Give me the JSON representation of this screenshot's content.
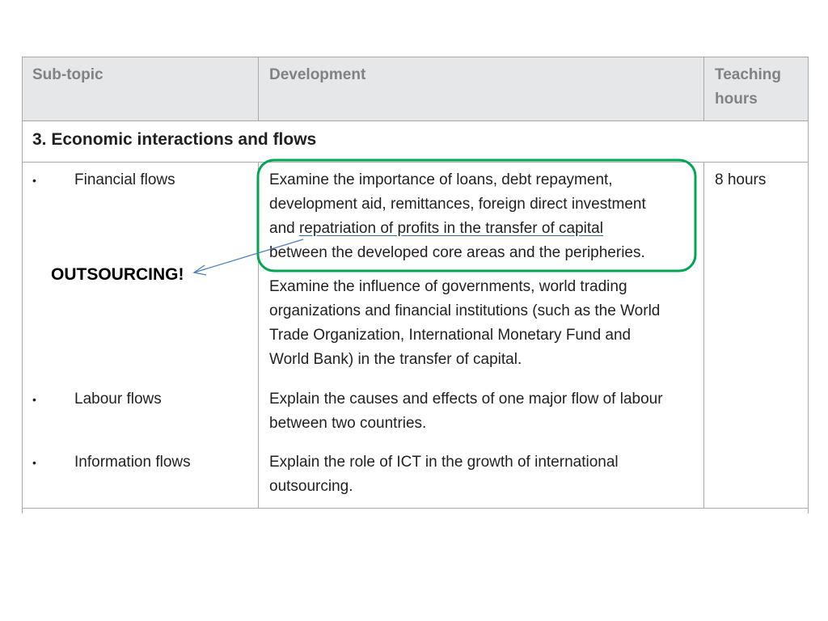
{
  "table": {
    "headers": {
      "subtopic": "Sub-topic",
      "development": "Development",
      "teaching_hours_line1": "Teaching",
      "teaching_hours_line2": "hours"
    },
    "section_title": "3. Economic interactions and flows",
    "rows": [
      {
        "bullet": "•",
        "subtopic": "Financial flows",
        "development_1": {
          "line1": "Examine the importance of loans, debt repayment,",
          "line2": "development aid, remittances, foreign direct investment",
          "line3_pre": "and ",
          "line3_underlined": "repatriation of profits in the transfer of capital",
          "line4": "between the developed core areas and the peripheries."
        },
        "development_2": {
          "line1": "Examine the influence of governments, world trading",
          "line2": "organizations and financial institutions (such as the World",
          "line3": "Trade Organization, International Monetary Fund and",
          "line4": "World Bank) in the transfer of capital."
        },
        "hours": "8 hours"
      },
      {
        "bullet": "•",
        "subtopic": "Labour flows",
        "development": {
          "line1": "Explain the causes and effects of one major flow of labour",
          "line2": "between two countries."
        }
      },
      {
        "bullet": "•",
        "subtopic": "Information flows",
        "development": {
          "line1": "Explain the role of ICT in the growth of international",
          "line2": "outsourcing."
        }
      }
    ]
  },
  "annotation": {
    "label": "OUTSOURCING!",
    "highlight_color": "#00a651",
    "arrow_color": "#4a7ebb",
    "underline_color": "#2e6da4"
  }
}
